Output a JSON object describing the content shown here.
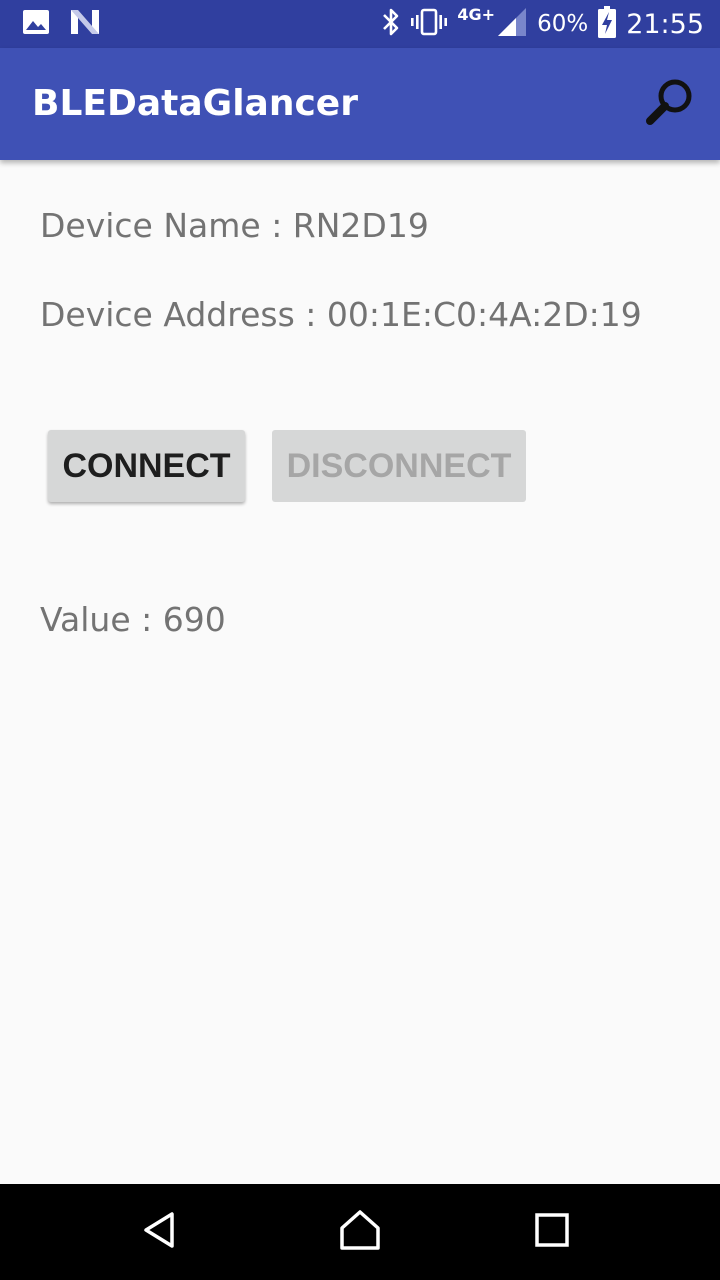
{
  "status_bar": {
    "left_icons": [
      "image-notification-icon",
      "n-notification-icon"
    ],
    "right_icons": [
      "bluetooth-icon",
      "vibrate-icon",
      "cell-signal-icon",
      "battery-charging-icon"
    ],
    "network": "4G+",
    "battery": "60%",
    "time": "21:55"
  },
  "app_bar": {
    "title": "BLEDataGlancer",
    "action_icon": "search-icon"
  },
  "device": {
    "name_line": "Device Name : RN2D19",
    "address_line": "Device Address : 00:1E:C0:4A:2D:19"
  },
  "buttons": {
    "connect": "CONNECT",
    "disconnect": "DISCONNECT"
  },
  "value_line": "Value : 690",
  "nav_bar": {
    "icons": [
      "back-icon",
      "home-icon",
      "recents-icon"
    ]
  },
  "colors": {
    "status_bar": "#303f9f",
    "app_bar": "#3f51b5",
    "background": "#fafafa",
    "button": "#d6d7d7",
    "text_secondary": "#737373"
  }
}
